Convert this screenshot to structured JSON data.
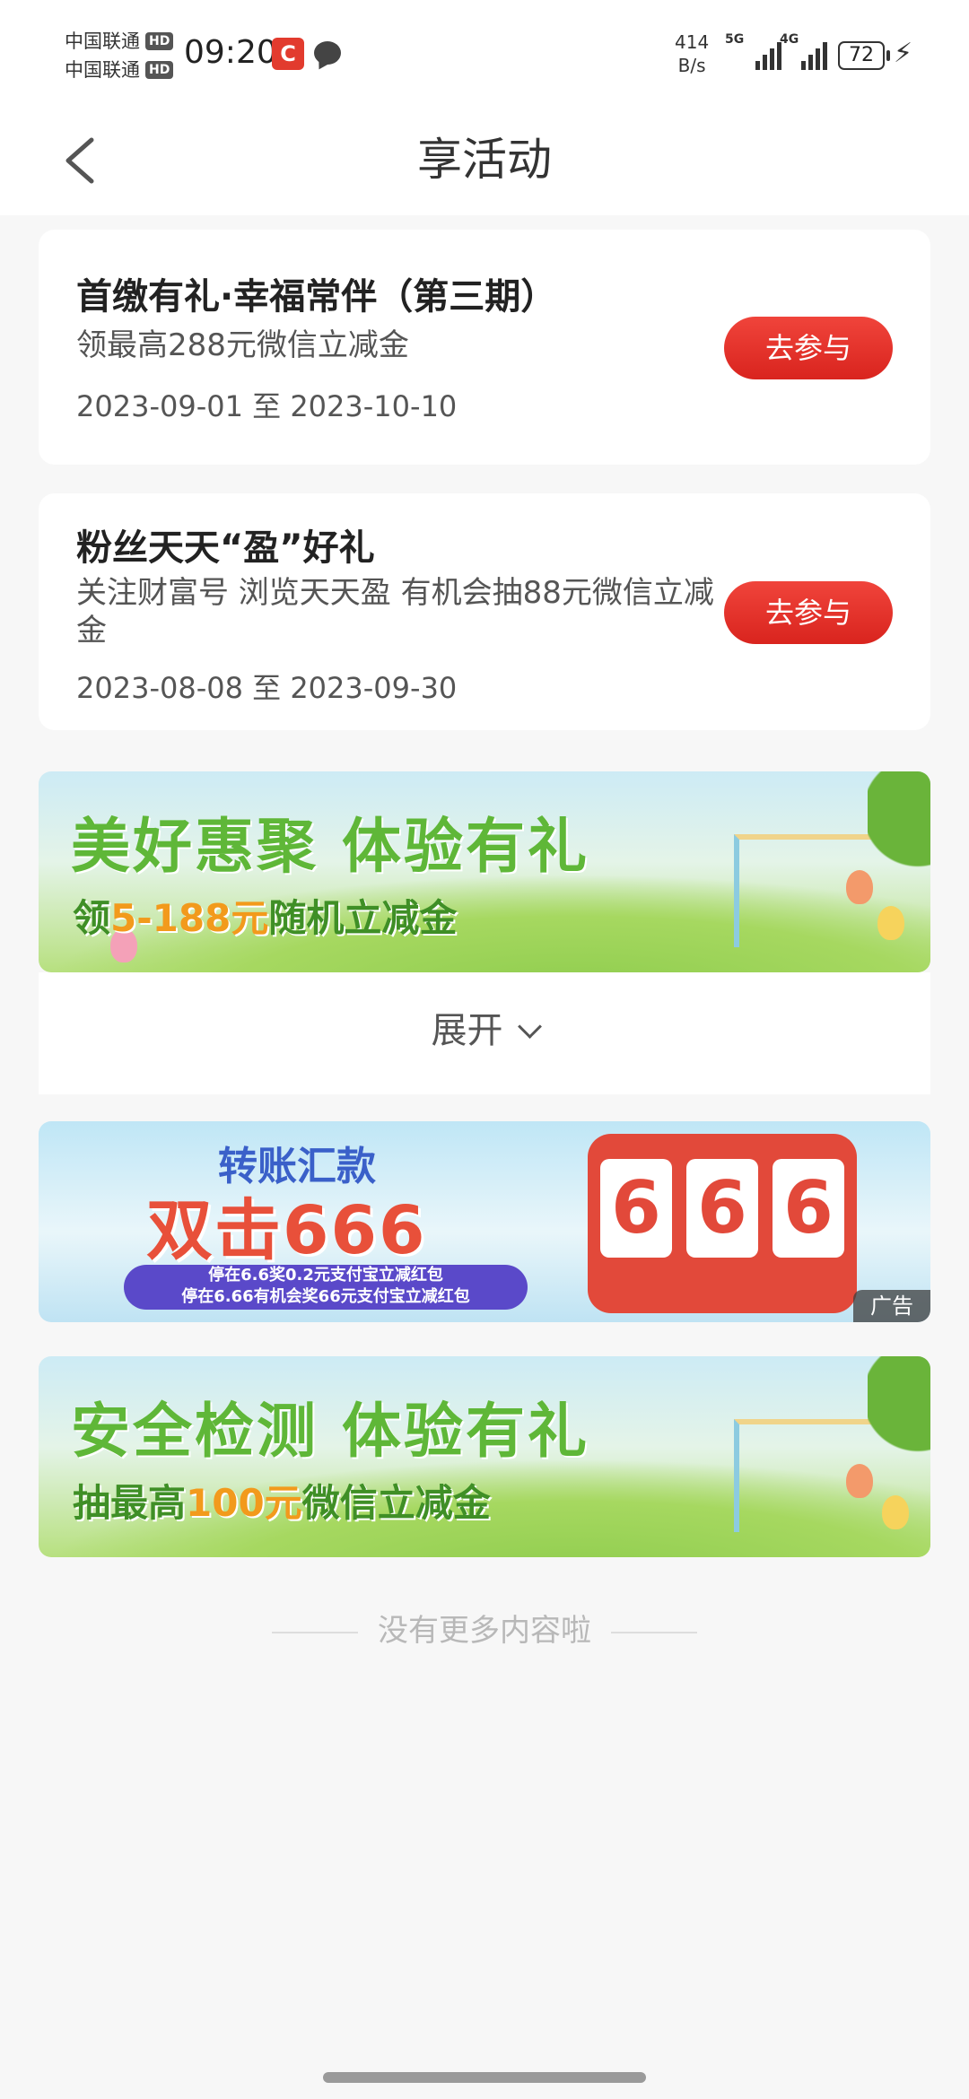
{
  "status_bar": {
    "carrier1": "中国联通",
    "carrier2": "中国联通",
    "hd": "HD",
    "time": "09:20",
    "speed_value": "414",
    "speed_unit": "B/s",
    "signal1": "5G",
    "signal2": "4G",
    "battery": "72"
  },
  "nav": {
    "title": "享活动",
    "back_icon": "chevron-left-icon"
  },
  "activities": [
    {
      "title": "首缴有礼·幸福常伴（第三期）",
      "desc": "领最高288元微信立减金",
      "date": "2023-09-01 至 2023-10-10",
      "button": "去参与"
    },
    {
      "title": "粉丝天天“盈”好礼",
      "desc": "关注财富号 浏览天天盈 有机会抽88元微信立减金",
      "date": "2023-08-08 至 2023-09-30",
      "button": "去参与"
    }
  ],
  "banner1": {
    "title": "美好惠聚 体验有礼",
    "sub_pre": "领",
    "sub_hl": "5-188元",
    "sub_post": "随机立减金"
  },
  "expand": {
    "label": "展开"
  },
  "banner2": {
    "line1": "转账汇款",
    "line2": "双击666",
    "pill1": "停在6.6奖0.2元支付宝立减红包",
    "pill2": "停在6.66有机会奖66元支付宝立减红包",
    "d1": "6",
    "d2": "6",
    "d3": "6",
    "ad": "广告"
  },
  "banner3": {
    "title": "安全检测 体验有礼",
    "sub_pre": "抽最高",
    "sub_hl": "100元",
    "sub_post": "微信立减金"
  },
  "footer": "没有更多内容啦",
  "colors": {
    "accent": "#e53328",
    "banner_green": "#5fb738"
  }
}
